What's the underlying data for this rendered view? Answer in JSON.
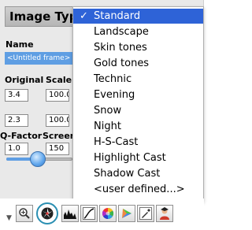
{
  "panel": {
    "image_type_label": "Image Type",
    "name_label": "Name",
    "name_value": "<Untitled frame>",
    "original_label": "Original",
    "scale_label": "Scale",
    "qfactor_label": "Q-Factor",
    "screen_label": "Screen",
    "fields": {
      "original_1": "3.4",
      "scale_1": "100.0",
      "original_2": "2.3",
      "scale_2": "100.0",
      "qfactor": "1.0",
      "screen": "150"
    },
    "slider_level": 0.5
  },
  "menu": {
    "selected_check": "✓",
    "items": [
      "Standard",
      "Landscape",
      "Skin tones",
      "Gold tones",
      "Technic",
      "Evening",
      "Snow",
      "Night",
      "H-S-Cast",
      "Highlight Cast",
      "Shadow Cast",
      "<user defined...>"
    ],
    "selected_index": 0
  },
  "toolbar": {
    "icons": [
      "dropdown-arrow-icon",
      "zoom-icon",
      "aperture-icon",
      "histogram-icon",
      "curve-icon",
      "color-wheel-icon",
      "gamut-icon",
      "eyedropper-icon",
      "user-icon"
    ],
    "accent": "#2a8fb2"
  },
  "colors": {
    "selection": "#2e63d7",
    "field_highlight": "#5f9ee3"
  }
}
